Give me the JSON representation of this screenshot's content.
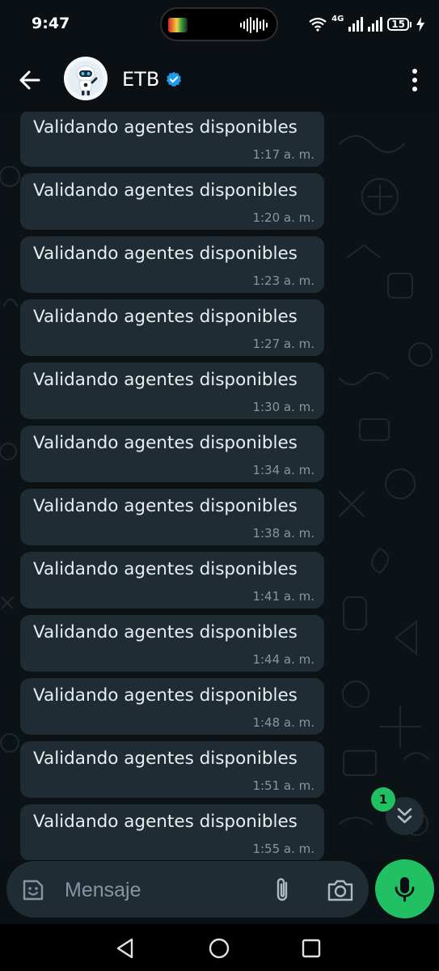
{
  "status_bar": {
    "time": "9:47",
    "network_label": "4G",
    "battery_level": "15"
  },
  "header": {
    "contact_name": "ETB",
    "verified_icon": "verified-badge-icon",
    "avatar_icon": "robot-avatar",
    "back_icon": "arrow-left-icon",
    "menu_icon": "more-vertical-icon"
  },
  "messages": [
    {
      "text": "Validando agentes disponibles",
      "time": "1:17 a. m."
    },
    {
      "text": "Validando agentes disponibles",
      "time": "1:20 a. m."
    },
    {
      "text": "Validando agentes disponibles",
      "time": "1:23 a. m."
    },
    {
      "text": "Validando agentes disponibles",
      "time": "1:27 a. m."
    },
    {
      "text": "Validando agentes disponibles",
      "time": "1:30 a. m."
    },
    {
      "text": "Validando agentes disponibles",
      "time": "1:34 a. m."
    },
    {
      "text": "Validando agentes disponibles",
      "time": "1:38 a. m."
    },
    {
      "text": "Validando agentes disponibles",
      "time": "1:41 a. m."
    },
    {
      "text": "Validando agentes disponibles",
      "time": "1:44 a. m."
    },
    {
      "text": "Validando agentes disponibles",
      "time": "1:48 a. m."
    },
    {
      "text": "Validando agentes disponibles",
      "time": "1:51 a. m."
    },
    {
      "text": "Validando agentes disponibles",
      "time": "1:55 a. m."
    }
  ],
  "scroll_down": {
    "unread_count": "1",
    "icon": "double-chevron-down-icon"
  },
  "composer": {
    "placeholder": "Mensaje",
    "emoji_icon": "sticker-icon",
    "attach_icon": "paperclip-icon",
    "camera_icon": "camera-icon",
    "mic_icon": "microphone-icon"
  },
  "colors": {
    "accent": "#21c063",
    "bubble": "#1f2c34",
    "background": "#0b1014",
    "timestamp": "#8696a0"
  }
}
